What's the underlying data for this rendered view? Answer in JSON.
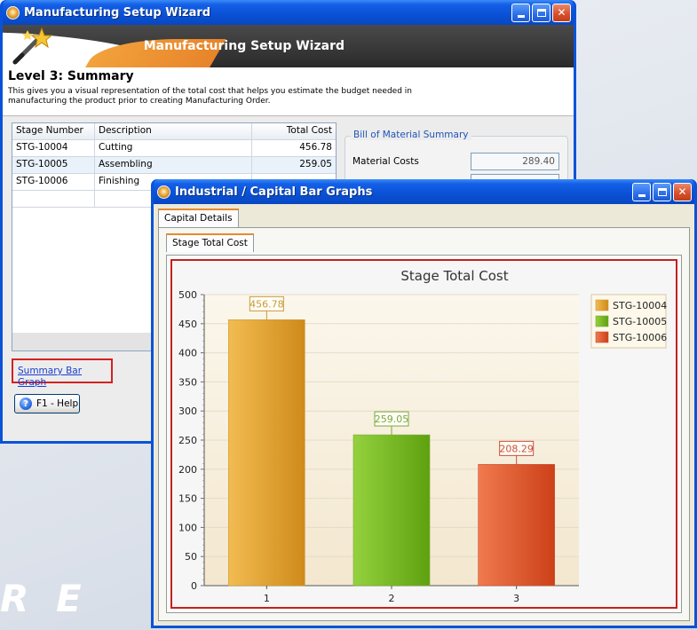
{
  "wizard": {
    "title": "Manufacturing Setup Wizard",
    "banner_title": "Manufacturing Setup Wizard",
    "level": "Level 3: Summary",
    "description": "This gives you a visual representation of the total cost that helps you estimate the budget needed in manufacturing the product prior to creating Manufacturing Order.",
    "grid": {
      "columns": [
        "Stage Number",
        "Description",
        "Total Cost"
      ],
      "rows": [
        [
          "STG-10004",
          "Cutting",
          "456.78"
        ],
        [
          "STG-10005",
          "Assembling",
          "259.05"
        ],
        [
          "STG-10006",
          "Finishing",
          ""
        ]
      ]
    },
    "bom": {
      "title": "Bill of Material Summary",
      "material_costs_label": "Material Costs",
      "material_costs_value": "289.40"
    },
    "summary_link": "Summary Bar Graph",
    "help_button": "F1 - Help"
  },
  "graph_window": {
    "title": "Industrial / Capital Bar Graphs",
    "outer_tab": "Capital Details",
    "inner_tab": "Stage Total Cost"
  },
  "colors": {
    "series": [
      "#e0a030",
      "#7cbf2a",
      "#e05a2e"
    ],
    "label_borders": [
      "#c99a3a",
      "#7aa83a",
      "#c8503a"
    ],
    "titlebar": "#0a52d6"
  },
  "chart_data": {
    "type": "bar",
    "title": "Stage Total Cost",
    "categories": [
      "1",
      "2",
      "3"
    ],
    "values": [
      456.78,
      259.05,
      208.29
    ],
    "data_labels": [
      "456.78",
      "259.05",
      "208.29"
    ],
    "legend": [
      "STG-10004",
      "STG-10005",
      "STG-10006"
    ],
    "legend_placement": "top-right",
    "ylim": [
      0,
      500
    ],
    "yticks": [
      0,
      50,
      100,
      150,
      200,
      250,
      300,
      350,
      400,
      450,
      500
    ],
    "xlabel": "",
    "ylabel": "",
    "grid": true
  }
}
